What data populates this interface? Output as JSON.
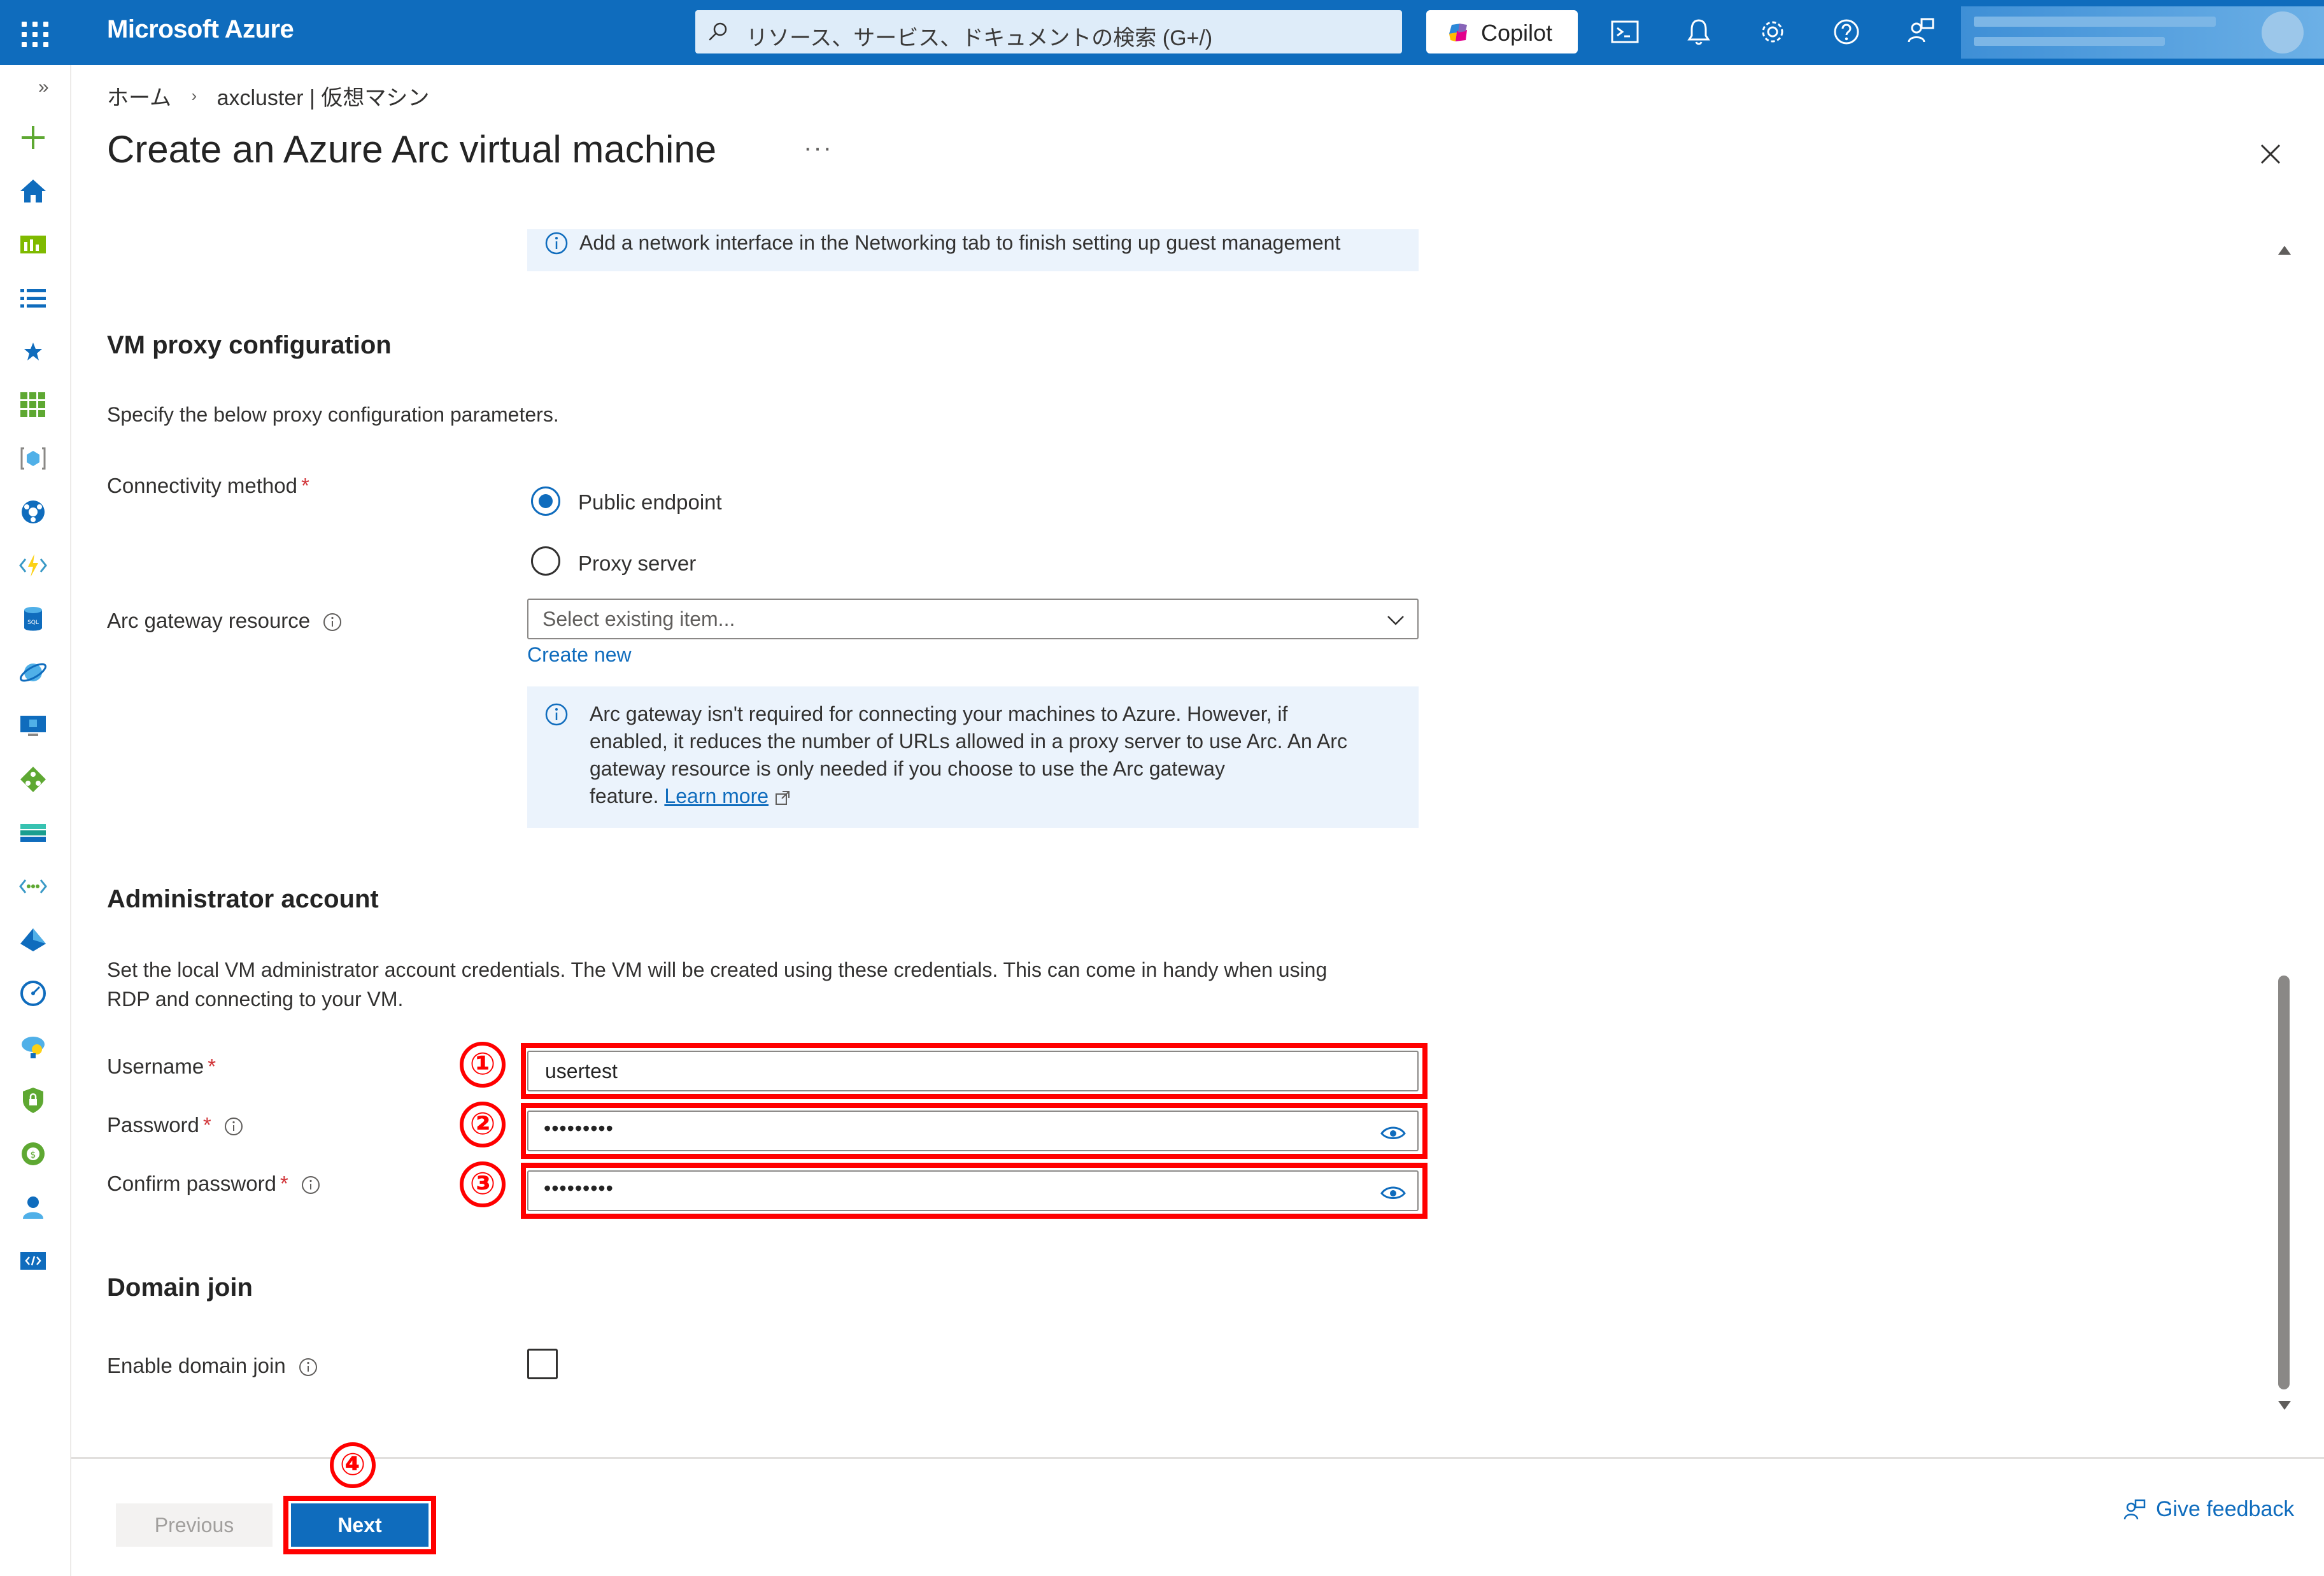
{
  "topbar": {
    "brand": "Microsoft Azure",
    "search_placeholder": "リソース、サービス、ドキュメントの検索 (G+/)",
    "copilot_label": "Copilot",
    "accent_color": "#0f6cbd"
  },
  "breadcrumb": {
    "home": "ホーム",
    "separator": "›",
    "current": "axcluster | 仮想マシン"
  },
  "page": {
    "title": "Create an Azure Arc virtual machine",
    "more": "···"
  },
  "top_info": {
    "text": "Add a network interface in the Networking tab to finish setting up guest management"
  },
  "proxy": {
    "heading": "VM proxy configuration",
    "description": "Specify the below proxy configuration parameters.",
    "connectivity_label": "Connectivity method",
    "required_mark": "*",
    "options": [
      "Public endpoint",
      "Proxy server"
    ],
    "selected_option": "Public endpoint",
    "arc_gateway_label": "Arc gateway resource",
    "arc_gateway_placeholder": "Select existing item...",
    "create_new": "Create new",
    "info_line1": "Arc gateway isn't required for connecting your machines to Azure. However, if",
    "info_line2": "enabled, it reduces the number of URLs allowed in a proxy server to use Arc. An Arc",
    "info_line3": "gateway resource is only needed if you choose to use the Arc gateway",
    "info_line4": "feature.",
    "learn_more": "Learn more"
  },
  "admin": {
    "heading": "Administrator account",
    "description_line1": "Set the local VM administrator account credentials. The VM will be created using these credentials. This can come in handy when using",
    "description_line2": "RDP and connecting to your VM.",
    "username_label": "Username",
    "username_value": "usertest",
    "password_label": "Password",
    "password_value": "•••••••••",
    "confirm_label": "Confirm password",
    "confirm_value": "•••••••••"
  },
  "domain": {
    "heading": "Domain join",
    "enable_label": "Enable domain join",
    "enabled": false
  },
  "annotations": {
    "badge1": "①",
    "badge2": "②",
    "badge3": "③",
    "badge4": "④",
    "highlight_color": "#ff0000"
  },
  "footer": {
    "previous": "Previous",
    "next": "Next",
    "feedback": "Give feedback"
  }
}
